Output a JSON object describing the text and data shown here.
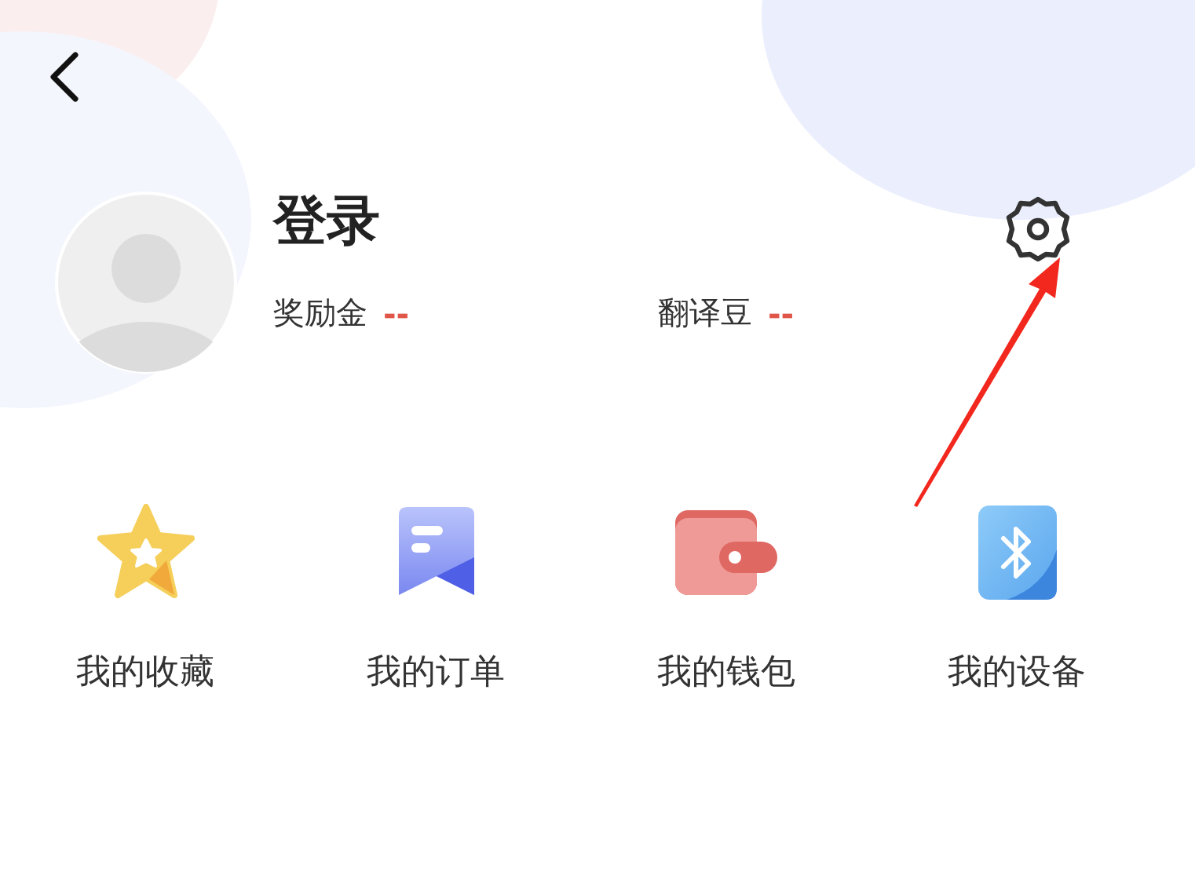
{
  "profile": {
    "name": "登录",
    "stats": [
      {
        "label": "奖励金",
        "value": "--"
      },
      {
        "label": "翻译豆",
        "value": "--"
      }
    ]
  },
  "shortcuts": [
    {
      "kind": "star",
      "label": "我的收藏"
    },
    {
      "kind": "order",
      "label": "我的订单"
    },
    {
      "kind": "wallet",
      "label": "我的钱包"
    },
    {
      "kind": "bluetooth",
      "label": "我的设备"
    }
  ]
}
